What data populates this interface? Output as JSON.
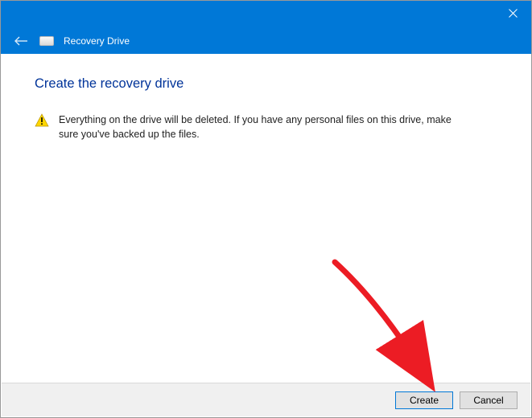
{
  "window": {
    "app_title": "Recovery Drive"
  },
  "page": {
    "heading": "Create the recovery drive",
    "warning_text": "Everything on the drive will be deleted. If you have any personal files on this drive, make sure you've backed up the files."
  },
  "buttons": {
    "create": "Create",
    "cancel": "Cancel"
  },
  "icons": {
    "close": "close-icon",
    "back": "back-arrow-icon",
    "app": "drive-icon",
    "warning": "warning-triangle-icon"
  },
  "colors": {
    "accent": "#0078d7",
    "heading": "#003399",
    "annotation": "#ec1c24"
  }
}
